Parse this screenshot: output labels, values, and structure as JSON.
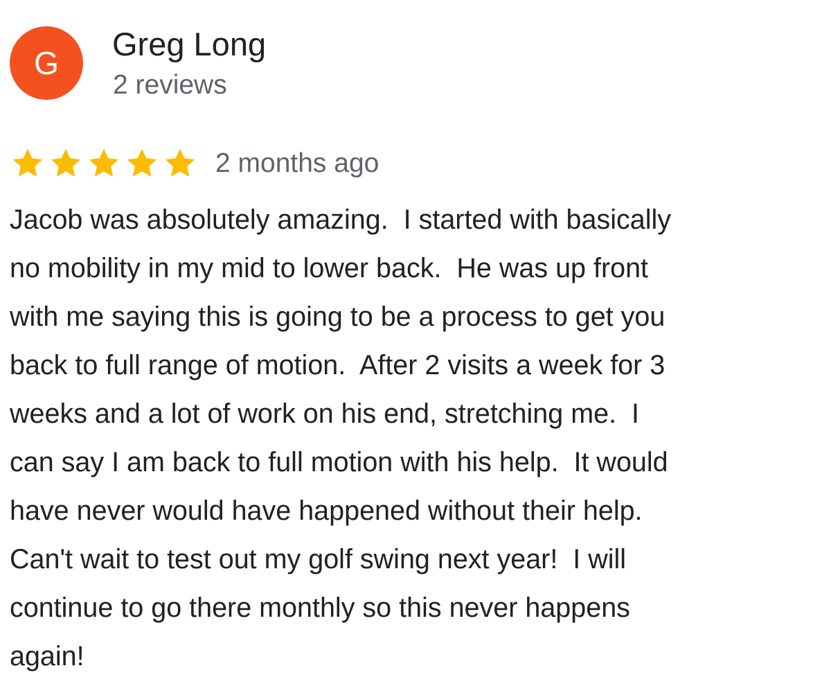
{
  "colors": {
    "avatar_bg": "#f4511e",
    "star": "#fbbc04"
  },
  "author": {
    "initial": "G",
    "name": "Greg Long",
    "meta": "2 reviews"
  },
  "review": {
    "rating": 5,
    "rating_max": 5,
    "date": "2 months ago",
    "text_lines": [
      "Jacob was absolutely amazing.  I started with basically",
      "no mobility in my mid to lower back.  He was up front",
      "with me saying this is going to be a process to get you",
      "back to full range of motion.  After 2 visits a week for 3",
      "weeks and a lot of work on his end, stretching me.  I",
      "can say I am back to full motion with his help.  It would",
      "have never would have happened without their help.",
      "Can't wait to test out my golf swing next year!  I will",
      "continue to go there monthly so this never happens",
      "again!"
    ]
  }
}
